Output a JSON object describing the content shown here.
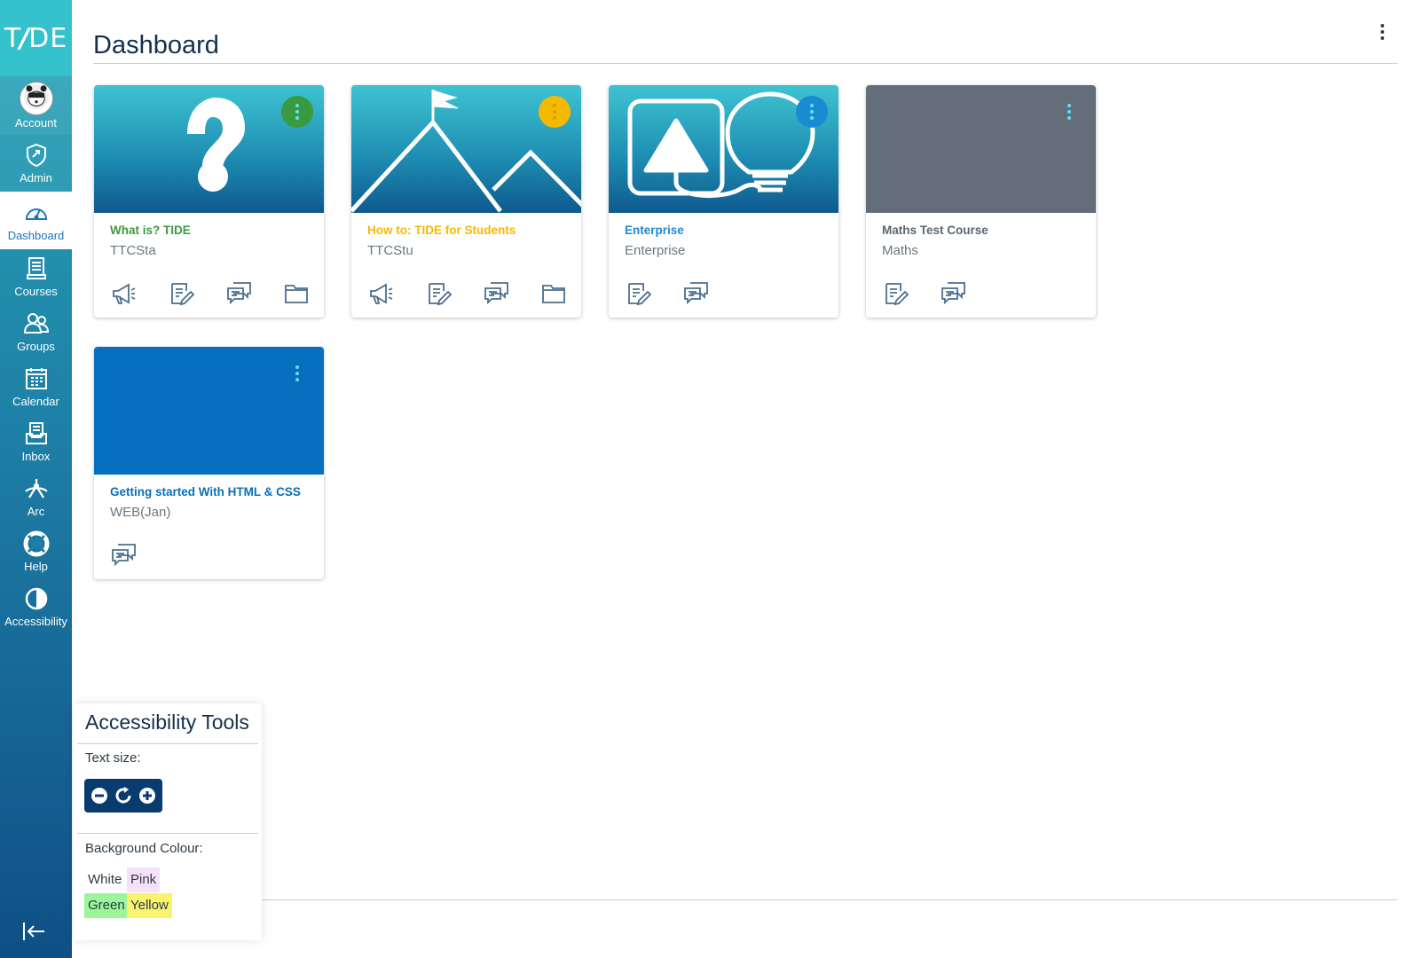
{
  "nav": {
    "logo": {
      "left": "T",
      "slash": "/",
      "right": "DE"
    },
    "items": [
      {
        "label": "Account",
        "icon": "avatar-icon"
      },
      {
        "label": "Admin",
        "icon": "shield-icon"
      },
      {
        "label": "Dashboard",
        "icon": "dashboard-gauge-icon"
      },
      {
        "label": "Courses",
        "icon": "book-icon"
      },
      {
        "label": "Groups",
        "icon": "groups-icon"
      },
      {
        "label": "Calendar",
        "icon": "calendar-icon"
      },
      {
        "label": "Inbox",
        "icon": "inbox-icon"
      },
      {
        "label": "Arc",
        "icon": "arc-icon"
      },
      {
        "label": "Help",
        "icon": "lifebuoy-icon"
      },
      {
        "label": "Accessibility",
        "icon": "contrast-icon"
      }
    ],
    "collapse_icon": "collapse-left-icon"
  },
  "header": {
    "title": "Dashboard"
  },
  "cards": [
    {
      "name": "What is? TIDE",
      "code": "TTCSta",
      "color": "#3a9a3f",
      "menu_color": "#3a9a3f",
      "art": "question-mark"
    },
    {
      "name": "How to: TIDE for Students",
      "code": "TTCStu",
      "color": "#f5b900",
      "menu_color": "#f5b900",
      "art": "mountain-flag"
    },
    {
      "name": "Enterprise",
      "code": "Enterprise",
      "color": "#1a8ad1",
      "menu_color": "#1a8ad1",
      "art": "lightbulb"
    },
    {
      "name": "Maths Test Course",
      "code": "Maths",
      "color": "#5b6672",
      "menu_color": "#646e7b",
      "art": "none"
    },
    {
      "name": "Getting started With HTML & CSS",
      "code": "WEB(Jan)",
      "color": "#0a70b8",
      "menu_color": "#0770be",
      "art": "none"
    }
  ],
  "accessibility": {
    "title": "Accessibility Tools",
    "text_size_label": "Text size:",
    "background_label": "Background Colour:",
    "swatches": [
      {
        "label": "White",
        "color": "#ffffff"
      },
      {
        "label": "Pink",
        "color": "#f7e1fa"
      },
      {
        "label": "Green",
        "color": "#9bf59b"
      },
      {
        "label": "Yellow",
        "color": "#faf36c"
      }
    ]
  }
}
